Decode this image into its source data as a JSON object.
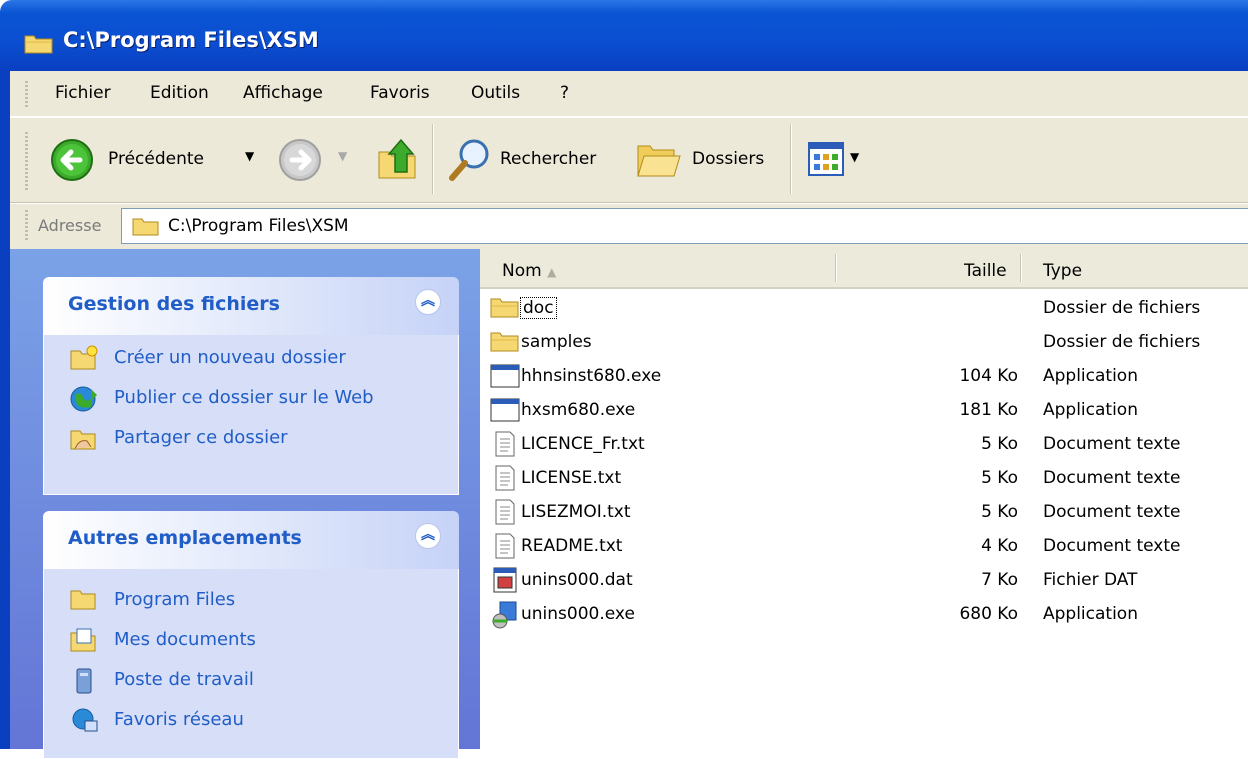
{
  "window": {
    "title": "C:\\Program Files\\XSM"
  },
  "menu": {
    "items": [
      "Fichier",
      "Edition",
      "Affichage",
      "Favoris",
      "Outils",
      "?"
    ]
  },
  "toolbar": {
    "back_label": "Précédente",
    "search_label": "Rechercher",
    "folders_label": "Dossiers"
  },
  "address": {
    "label": "Adresse",
    "value": "C:\\Program Files\\XSM"
  },
  "task_pane": {
    "file_tasks": {
      "title": "Gestion des fichiers",
      "items": [
        {
          "label": "Créer un nouveau dossier",
          "icon": "new-folder-icon"
        },
        {
          "label": "Publier ce dossier sur le Web",
          "icon": "web-publish-icon"
        },
        {
          "label": "Partager ce dossier",
          "icon": "share-folder-icon"
        }
      ]
    },
    "other_places": {
      "title": "Autres emplacements",
      "items": [
        {
          "label": "Program Files",
          "icon": "folder-icon"
        },
        {
          "label": "Mes documents",
          "icon": "my-documents-icon"
        },
        {
          "label": "Poste de travail",
          "icon": "my-computer-icon"
        },
        {
          "label": "Favoris réseau",
          "icon": "network-places-icon"
        }
      ]
    }
  },
  "columns": {
    "name": "Nom",
    "size": "Taille",
    "type": "Type"
  },
  "files": [
    {
      "name": "doc",
      "size": "",
      "type": "Dossier de fichiers",
      "icon": "folder-icon"
    },
    {
      "name": "samples",
      "size": "",
      "type": "Dossier de fichiers",
      "icon": "folder-icon"
    },
    {
      "name": "hhnsinst680.exe",
      "size": "104 Ko",
      "type": "Application",
      "icon": "application-icon"
    },
    {
      "name": "hxsm680.exe",
      "size": "181 Ko",
      "type": "Application",
      "icon": "application-icon"
    },
    {
      "name": "LICENCE_Fr.txt",
      "size": "5 Ko",
      "type": "Document texte",
      "icon": "text-file-icon"
    },
    {
      "name": "LICENSE.txt",
      "size": "5 Ko",
      "type": "Document texte",
      "icon": "text-file-icon"
    },
    {
      "name": "LISEZMOI.txt",
      "size": "5 Ko",
      "type": "Document texte",
      "icon": "text-file-icon"
    },
    {
      "name": "README.txt",
      "size": "4 Ko",
      "type": "Document texte",
      "icon": "text-file-icon"
    },
    {
      "name": "unins000.dat",
      "size": "7 Ko",
      "type": "Fichier DAT",
      "icon": "dat-file-icon"
    },
    {
      "name": "unins000.exe",
      "size": "680 Ko",
      "type": "Application",
      "icon": "installer-icon"
    }
  ],
  "colors": {
    "titlebar": "#0a55d4",
    "taskpane_bg": "#6f8fdf",
    "task_link": "#215dc6",
    "toolbar_bg": "#ece9d8"
  }
}
